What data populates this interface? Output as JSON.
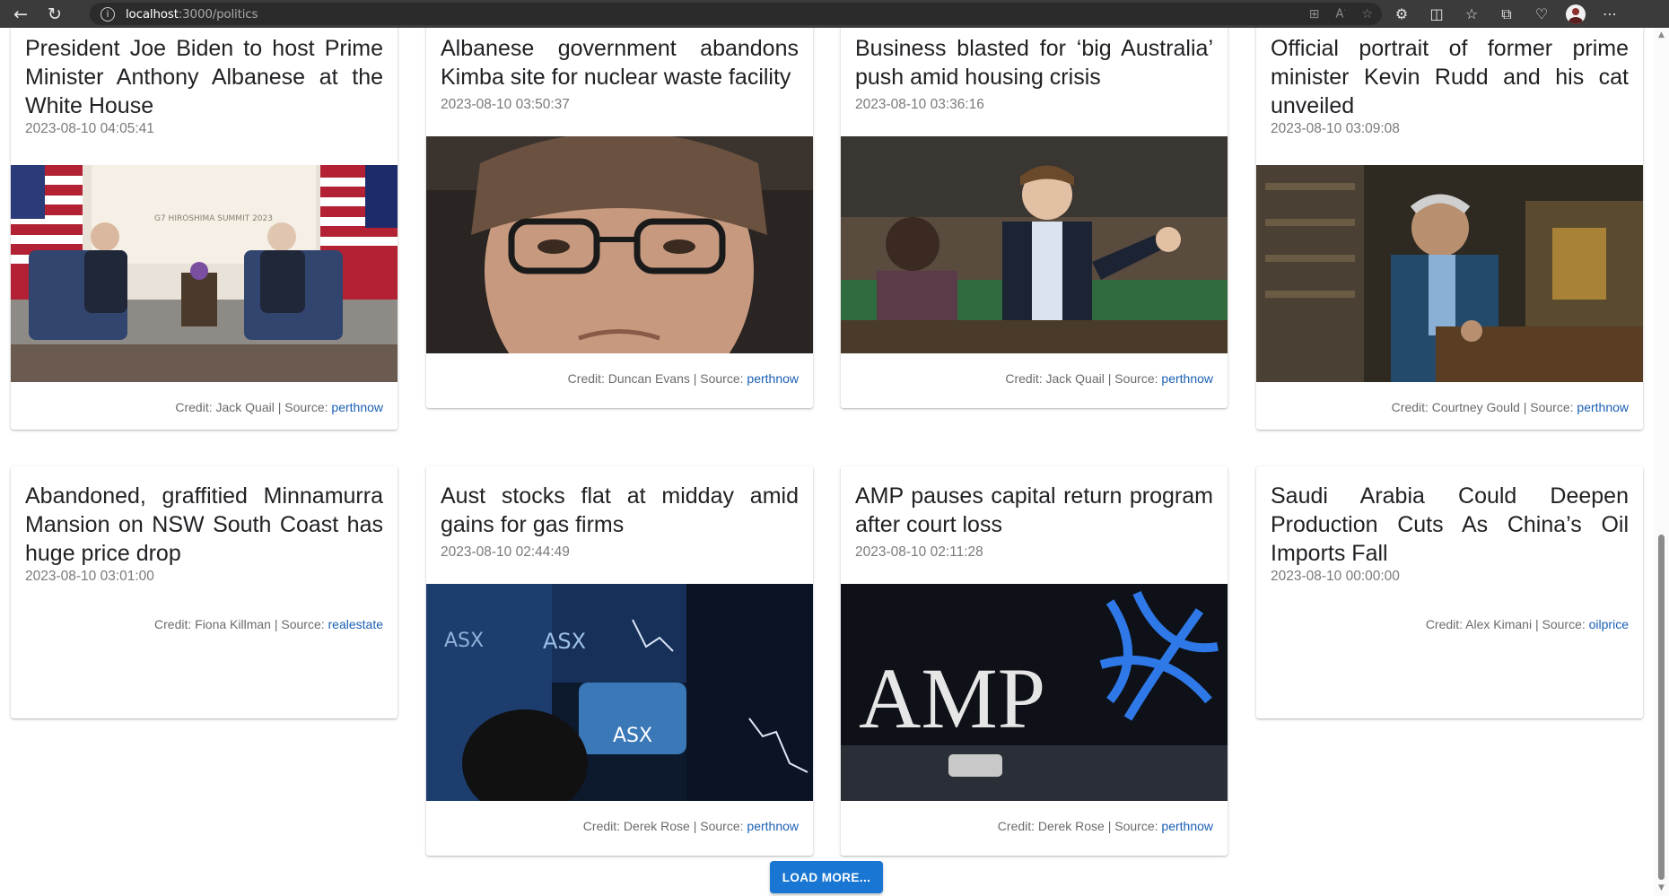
{
  "browser": {
    "url_host": "localhost",
    "url_rest": ":3000/politics",
    "back_icon": "←",
    "reload_icon": "↻"
  },
  "articles": [
    {
      "title": "President Joe Biden to host Prime Minister Anthony Albanese at the White House",
      "date": "2023-08-10 04:05:41",
      "credit": "Credit: Jack Quail | Source: ",
      "source": "perthnow",
      "image": "g7-summit"
    },
    {
      "title": "Albanese government abandons Kimba site for nuclear waste facility",
      "date": "2023-08-10 03:50:37",
      "credit": "Credit: Duncan Evans | Source: ",
      "source": "perthnow",
      "image": "woman-portrait"
    },
    {
      "title": "Business blasted for ‘big Australia’ push amid housing crisis",
      "date": "2023-08-10 03:36:16",
      "credit": "Credit: Jack Quail | Source: ",
      "source": "perthnow",
      "image": "parliament-speaker"
    },
    {
      "title": "Official portrait of former prime minister Kevin Rudd and his cat unveiled",
      "date": "2023-08-10 03:09:08",
      "credit": "Credit: Courtney Gould | Source: ",
      "source": "perthnow",
      "image": "painted-portrait"
    },
    {
      "title": "Abandoned, graffitied Minnamurra Mansion on NSW South Coast has huge price drop",
      "date": "2023-08-10 03:01:00",
      "credit": "Credit: Fiona Killman | Source: ",
      "source": "realestate",
      "image": ""
    },
    {
      "title": "Aust stocks flat at midday amid gains for gas firms",
      "date": "2023-08-10 02:44:49",
      "credit": "Credit: Derek Rose | Source: ",
      "source": "perthnow",
      "image": "asx-screens"
    },
    {
      "title": "AMP pauses capital return program after court loss",
      "date": "2023-08-10 02:11:28",
      "credit": "Credit: Derek Rose | Source: ",
      "source": "perthnow",
      "image": "amp-sign"
    },
    {
      "title": "Saudi Arabia Could Deepen Production Cuts As China’s Oil Imports Fall",
      "date": "2023-08-10 00:00:00",
      "credit": "Credit: Alex Kimani | Source: ",
      "source": "oilprice",
      "image": ""
    }
  ],
  "image_text": {
    "g7_banner": "G7 HIROSHIMA SUMMIT 2023",
    "asx_label": "ASX",
    "amp_label": "AMP"
  },
  "load_more_label": "LOAD MORE...",
  "colors": {
    "accent": "#1976d2",
    "link": "#1a5fb4"
  }
}
